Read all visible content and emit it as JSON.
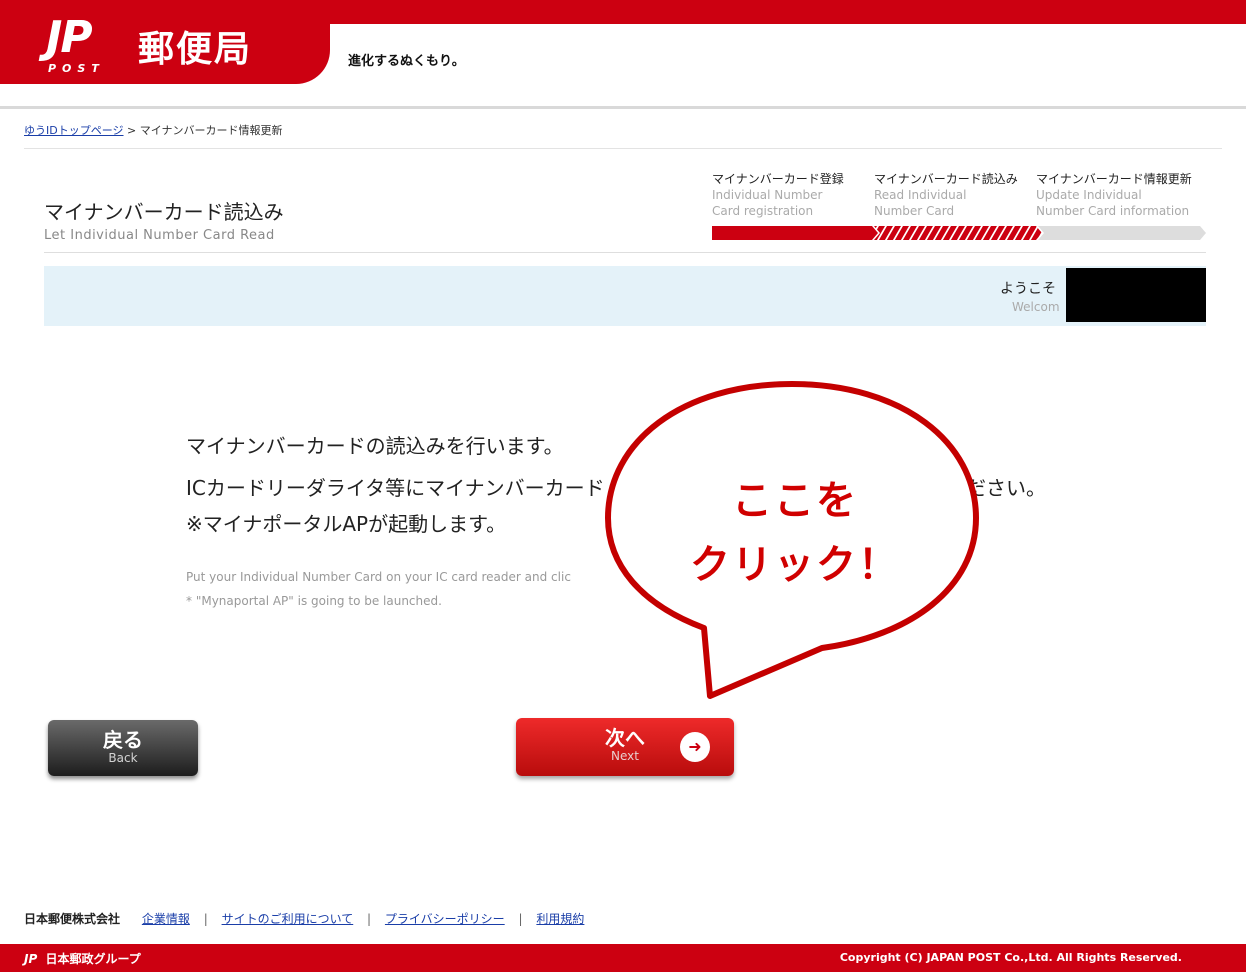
{
  "header": {
    "logo_mark": "JP",
    "logo_post": "POST",
    "brand_name": "郵便局",
    "tagline": "進化するぬくもり。"
  },
  "breadcrumb": {
    "home_link": "ゆうIDトップページ",
    "separator": ">",
    "current": "マイナンバーカード情報更新"
  },
  "page": {
    "title": "マイナンバーカード読込み",
    "subtitle": "Let Individual Number Card Read"
  },
  "steps": [
    {
      "ja": "マイナンバーカード登録",
      "en_line1": "Individual Number",
      "en_line2": "Card registration",
      "state": "done"
    },
    {
      "ja": "マイナンバーカード読込み",
      "en_line1": "Read Individual",
      "en_line2": "Number Card",
      "state": "current"
    },
    {
      "ja": "マイナンバーカード情報更新",
      "en_line1": "Update Individual",
      "en_line2": "Number Card information",
      "state": "todo"
    }
  ],
  "welcome": {
    "ja": "ようこそ",
    "en": "Welcom"
  },
  "instructions": {
    "line1": "マイナンバーカードの読込みを行います。",
    "line2": "ICカードリーダライタ等にマイナンバーカード",
    "line2_tail": "ださい。",
    "line3": "※マイナポータルAPが起動します。",
    "note1": "Put your Individual Number Card on your IC card reader and clic",
    "note2": "* \"Mynaportal AP\" is going to be launched."
  },
  "callout": {
    "line1": "ここを",
    "line2": "クリック！"
  },
  "buttons": {
    "back_label": "戻る",
    "back_en": "Back",
    "next_label": "次へ",
    "next_en": "Next",
    "next_arrow": "➜"
  },
  "footer": {
    "company": "日本郵便株式会社",
    "links": [
      "企業情報",
      "サイトのご利用について",
      "プライバシーポリシー",
      "利用規約"
    ],
    "separator": "|",
    "group_mark": "JP",
    "group_name": "日本郵政グループ",
    "copyright": "Copyright (C) JAPAN POST Co.,Ltd.  All Rights Reserved."
  },
  "colors": {
    "brand_red": "#cc0011",
    "welcome_bg": "#e4f2f9",
    "link_blue": "#1a3ea8",
    "step_todo": "#dddddd"
  }
}
